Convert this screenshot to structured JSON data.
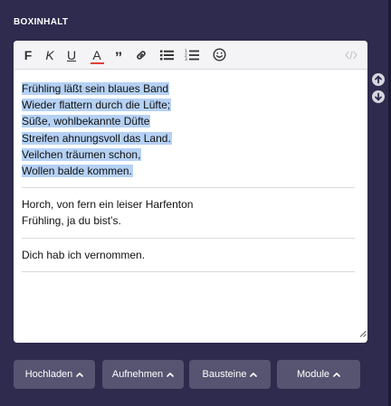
{
  "section": {
    "title": "BOXINHALT"
  },
  "toolbar": {
    "bold": "F",
    "italic": "K",
    "underline": "U",
    "text_color": "A",
    "quote": "”"
  },
  "content": {
    "paragraph1": [
      "Frühling läßt sein blaues Band",
      "Wieder flattern durch die Lüfte;",
      "Süße, wohlbekannte Düfte",
      "Streifen ahnungsvoll das Land.",
      "Veilchen träumen schon,",
      "Wollen balde kommen."
    ],
    "paragraph2": [
      "Horch, von fern ein leiser Harfenton",
      "Frühling, ja du bist’s."
    ],
    "paragraph3": [
      "Dich hab ich vernommen."
    ]
  },
  "buttons": {
    "upload": "Hochladen",
    "record": "Aufnehmen",
    "blocks": "Bausteine",
    "modules": "Module"
  },
  "colors": {
    "background": "#2e2b4e",
    "selection": "#b5d1f4",
    "text_color_underline": "#e0403a",
    "button": "#575471"
  }
}
